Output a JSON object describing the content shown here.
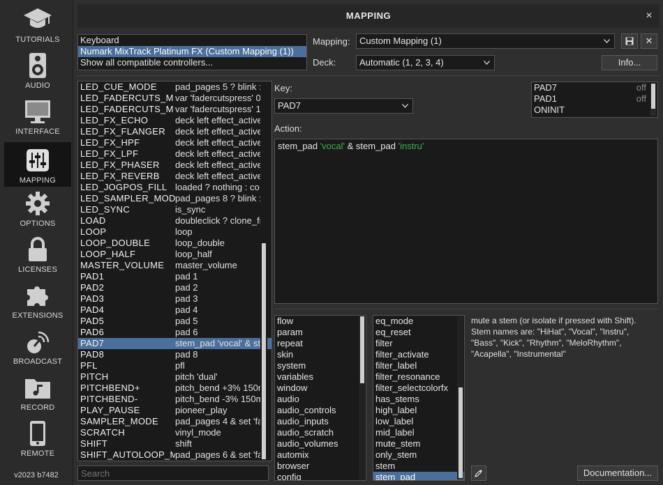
{
  "sidebar": {
    "items": [
      {
        "label": "TUTORIALS",
        "icon": "graduation-cap-icon"
      },
      {
        "label": "AUDIO",
        "icon": "speaker-icon"
      },
      {
        "label": "INTERFACE",
        "icon": "monitor-icon"
      },
      {
        "label": "MAPPING",
        "icon": "sliders-icon",
        "active": true
      },
      {
        "label": "OPTIONS",
        "icon": "gear-icon"
      },
      {
        "label": "LICENSES",
        "icon": "lock-icon"
      },
      {
        "label": "EXTENSIONS",
        "icon": "puzzle-icon"
      },
      {
        "label": "BROADCAST",
        "icon": "broadcast-icon"
      },
      {
        "label": "RECORD",
        "icon": "music-folder-icon"
      },
      {
        "label": "REMOTE",
        "icon": "phone-icon"
      }
    ],
    "version": "v2023 b7482"
  },
  "dialog": {
    "title": "MAPPING",
    "close": "×"
  },
  "controllers": {
    "items": [
      "Keyboard",
      "Numark MixTrack Platinum FX (Custom Mapping (1))",
      "Show all compatible controllers..."
    ],
    "selected_index": 1
  },
  "mapping_select": {
    "label": "Mapping:",
    "value": "Custom Mapping (1)"
  },
  "deck_select": {
    "label": "Deck:",
    "value": "Automatic (1, 2, 3, 4)"
  },
  "buttons": {
    "save": "💾",
    "delete": "✕",
    "info": "Info...",
    "documentation": "Documentation..."
  },
  "keylist": {
    "rows": [
      {
        "key": "LED_CUE_MODE",
        "action": "pad_pages 5 ? blink :"
      },
      {
        "key": "LED_FADERCUTS_M",
        "action": "var 'fadercutspress' 0"
      },
      {
        "key": "LED_FADERCUTS_M",
        "action": "var 'fadercutspress' 1"
      },
      {
        "key": "LED_FX_ECHO",
        "action": "deck left effect_active"
      },
      {
        "key": "LED_FX_FLANGER",
        "action": "deck left effect_active"
      },
      {
        "key": "LED_FX_HPF",
        "action": "deck left effect_active"
      },
      {
        "key": "LED_FX_LPF",
        "action": "deck left effect_active"
      },
      {
        "key": "LED_FX_PHASER",
        "action": "deck left effect_active"
      },
      {
        "key": "LED_FX_REVERB",
        "action": "deck left effect_active"
      },
      {
        "key": "LED_JOGPOS_FILL",
        "action": "loaded ? nothing : co"
      },
      {
        "key": "LED_SAMPLER_MOD",
        "action": "pad_pages 8 ? blink :"
      },
      {
        "key": "LED_SYNC",
        "action": "is_sync"
      },
      {
        "key": "LOAD",
        "action": "doubleclick ? clone_fr"
      },
      {
        "key": "LOOP",
        "action": "loop"
      },
      {
        "key": "LOOP_DOUBLE",
        "action": "loop_double"
      },
      {
        "key": "LOOP_HALF",
        "action": "loop_half"
      },
      {
        "key": "MASTER_VOLUME",
        "action": "master_volume"
      },
      {
        "key": "PAD1",
        "action": "pad 1"
      },
      {
        "key": "PAD2",
        "action": "pad 2"
      },
      {
        "key": "PAD3",
        "action": "pad 3"
      },
      {
        "key": "PAD4",
        "action": "pad 4"
      },
      {
        "key": "PAD5",
        "action": "pad 5"
      },
      {
        "key": "PAD6",
        "action": "pad 6"
      },
      {
        "key": "PAD7",
        "action": "stem_pad 'vocal' & st"
      },
      {
        "key": "PAD8",
        "action": "pad 8"
      },
      {
        "key": "PFL",
        "action": "pfl"
      },
      {
        "key": "PITCH",
        "action": "pitch 'dual'"
      },
      {
        "key": "PITCHBEND+",
        "action": "pitch_bend +3% 150m"
      },
      {
        "key": "PITCHBEND-",
        "action": "pitch_bend -3% 150m"
      },
      {
        "key": "PLAY_PAUSE",
        "action": "pioneer_play"
      },
      {
        "key": "SAMPLER_MODE",
        "action": "pad_pages 4 & set 'fa"
      },
      {
        "key": "SCRATCH",
        "action": "vinyl_mode"
      },
      {
        "key": "SHIFT",
        "action": "shift"
      },
      {
        "key": "SHIFT_AUTOLOOP_M",
        "action": "pad_pages 6 & set 'fa"
      }
    ],
    "selected_index": 23
  },
  "search": {
    "placeholder": "Search"
  },
  "key_select": {
    "label": "Key:",
    "value": "PAD7"
  },
  "key_status_list": {
    "rows": [
      {
        "name": "PAD7",
        "status": "off"
      },
      {
        "name": "PAD1",
        "status": "off"
      },
      {
        "name": "ONINIT",
        "status": ""
      }
    ]
  },
  "action": {
    "label": "Action:",
    "parts": [
      {
        "text": "stem_pad ",
        "kind": "plain"
      },
      {
        "text": "'vocal'",
        "kind": "string"
      },
      {
        "text": " & stem_pad ",
        "kind": "plain"
      },
      {
        "text": "'instru'",
        "kind": "string"
      }
    ]
  },
  "categories": {
    "items": [
      "flow",
      "param",
      "repeat",
      "skin",
      "system",
      "variables",
      "window",
      "audio",
      "audio_controls",
      "audio_inputs",
      "audio_scratch",
      "audio_volumes",
      "automix",
      "browser",
      "config"
    ]
  },
  "verbs": {
    "items": [
      "eq_mode",
      "eq_reset",
      "filter",
      "filter_activate",
      "filter_label",
      "filter_resonance",
      "filter_selectcolorfx",
      "has_stems",
      "high_label",
      "low_label",
      "mid_label",
      "mute_stem",
      "only_stem",
      "stem",
      "stem_pad"
    ],
    "selected_index": 14
  },
  "description": "mute a stem (or isolate if pressed with Shift). Stem names are: \"HiHat\", \"Vocal\", \"Instru\", \"Bass\", \"Kick\", \"Rhythm\", \"MeloRhythm\", \"Acapella\", \"Instrumental\"",
  "colors": {
    "selection": "#4b6f9c",
    "string_literal": "#3fae4a",
    "panel": "#1a1a1a"
  }
}
